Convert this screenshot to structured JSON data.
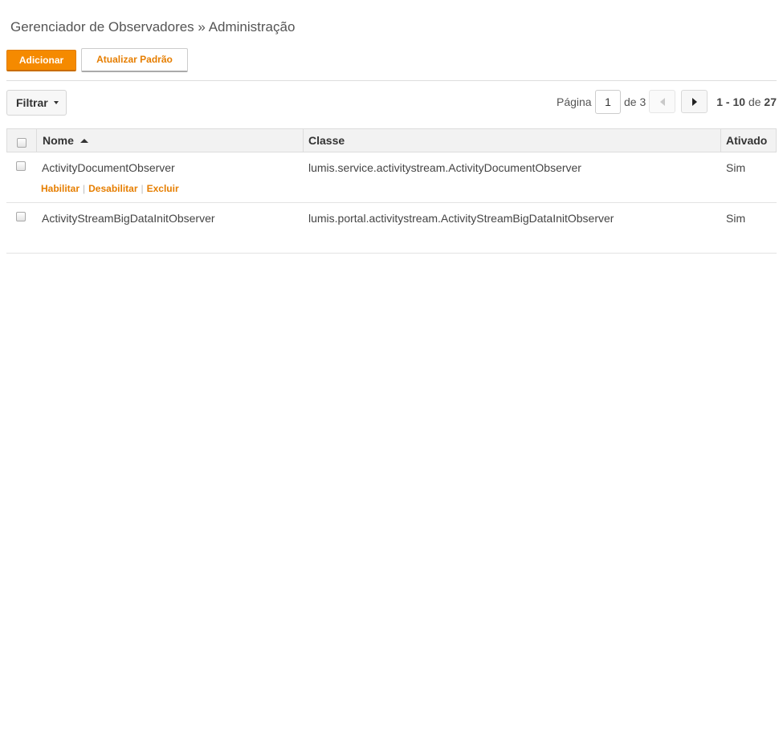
{
  "breadcrumb": {
    "section": "Gerenciador de Observadores",
    "separator": "»",
    "page": "Administração"
  },
  "toolbar": {
    "add_label": "Adicionar",
    "update_default_label": "Atualizar Padrão"
  },
  "filter": {
    "label": "Filtrar"
  },
  "pagination": {
    "page_label": "Página",
    "current_page": "1",
    "of_label": "de 3",
    "range": "1 - 10",
    "range_of": "de",
    "total": "27"
  },
  "table": {
    "columns": {
      "name": "Nome",
      "class": "Classe",
      "active": "Ativado"
    },
    "rows": [
      {
        "name": "ActivityDocumentObserver",
        "class": "lumis.service.activitystream.ActivityDocumentObserver",
        "active": "Sim",
        "actions": [
          "Habilitar",
          "Desabilitar",
          "Excluir"
        ]
      },
      {
        "name": "ActivityStreamBigDataInitObserver",
        "class": "lumis.portal.activitystream.ActivityStreamBigDataInitObserver",
        "active": "Sim"
      }
    ]
  },
  "colors": {
    "accent": "#f58a00",
    "link": "#e67e00"
  }
}
